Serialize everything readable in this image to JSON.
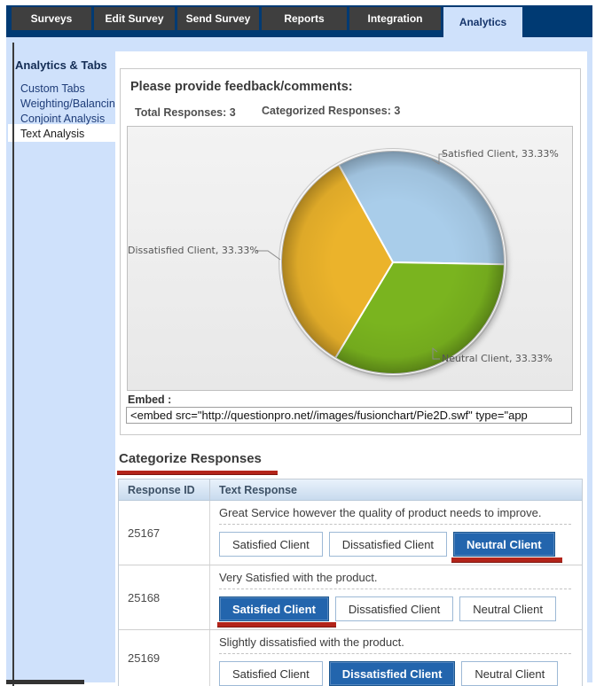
{
  "nav": {
    "tabs": [
      {
        "label": "Surveys",
        "active": false
      },
      {
        "label": "Edit Survey",
        "active": false
      },
      {
        "label": "Send Survey",
        "active": false
      },
      {
        "label": "Reports",
        "active": false
      },
      {
        "label": "Integration",
        "active": false
      },
      {
        "label": "Analytics",
        "active": true
      }
    ]
  },
  "sidebar": {
    "heading": "Analytics & Tabs",
    "items": [
      {
        "label": "Custom Tabs",
        "active": false
      },
      {
        "label": "Weighting/Balancing",
        "active": false
      },
      {
        "label": "Conjoint Analysis",
        "active": false
      },
      {
        "label": "Text Analysis",
        "active": true
      }
    ]
  },
  "feedback_panel": {
    "question_title": "Please provide feedback/comments:",
    "total_responses_label": "Total Responses: 3",
    "categorized_responses_label": "Categorized Responses: 3",
    "embed_label": "Embed :",
    "embed_value": "<embed src=\"http://questionpro.net//images/fusionchart/Pie2D.swf\" type=\"app"
  },
  "chart_data": {
    "type": "pie",
    "unit": "%",
    "total_responses": 3,
    "categorized_responses": 3,
    "series": [
      {
        "label": "Satisfied Client",
        "value": 33.33,
        "callout": "Satisfied Client, 33.33%",
        "color": "#a9cdea"
      },
      {
        "label": "Dissatisfied Client",
        "value": 33.33,
        "callout": "Dissatisfied Client, 33.33%",
        "color": "#ebb32b"
      },
      {
        "label": "Neutral Client",
        "value": 33.33,
        "callout": "Neutral Client, 33.33%",
        "color": "#7ab41f"
      }
    ],
    "legend_position": "callout-labels"
  },
  "categorize": {
    "title": "Categorize Responses",
    "columns": [
      "Response ID",
      "Text Response"
    ],
    "rows": [
      {
        "id": "25167",
        "text": "Great Service however the quality of product needs to improve.",
        "options": [
          "Satisfied Client",
          "Dissatisfied Client",
          "Neutral Client"
        ],
        "selected": "Neutral Client"
      },
      {
        "id": "25168",
        "text": "Very Satisfied with the product.",
        "options": [
          "Satisfied Client",
          "Dissatisfied Client",
          "Neutral Client"
        ],
        "selected": "Satisfied Client"
      },
      {
        "id": "25169",
        "text": "Slightly dissatisfied with the product.",
        "options": [
          "Satisfied Client",
          "Dissatisfied Client",
          "Neutral Client"
        ],
        "selected": "Dissatisfied Client"
      }
    ]
  },
  "annotations": {
    "marker_color": "#b3241a"
  }
}
